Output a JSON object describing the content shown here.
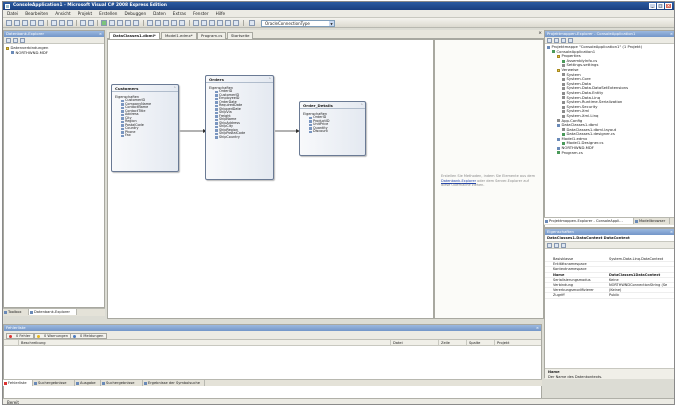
{
  "window": {
    "title": "ConsoleApplication1 - Microsoft Visual C# 2008 Express Edition",
    "controls": [
      "_",
      "□",
      "×"
    ]
  },
  "menu": [
    "Datei",
    "Bearbeiten",
    "Ansicht",
    "Projekt",
    "Erstellen",
    "Debuggen",
    "Daten",
    "Extras",
    "Fenster",
    "Hilfe"
  ],
  "toolbar": {
    "connection_type": "OracleConnectionType"
  },
  "db_explorer": {
    "title": "Datenbank-Explorer",
    "items": [
      {
        "label": "Datenverbindungen",
        "level": 0,
        "icon": "folder-icon"
      },
      {
        "label": "NORTHWND.MDF",
        "level": 1,
        "icon": "database-icon"
      }
    ],
    "tabs": [
      "Toolbox",
      "Datenbank-Explorer"
    ]
  },
  "doc_tabs": [
    "DataClasses1.dbml*",
    "Model1.edmx*",
    "Program.cs",
    "Startseite"
  ],
  "designer": {
    "entities": [
      {
        "name": "Customers",
        "section": "Eigenschaften",
        "props": [
          "CustomerID",
          "CompanyName",
          "ContactName",
          "ContactTitle",
          "Address",
          "City",
          "Region",
          "PostalCode",
          "Country",
          "Phone",
          "Fax"
        ]
      },
      {
        "name": "Orders",
        "section": "Eigenschaften",
        "props": [
          "OrderID",
          "CustomerID",
          "EmployeeID",
          "OrderDate",
          "RequiredDate",
          "ShippedDate",
          "ShipVia",
          "Freight",
          "ShipName",
          "ShipAddress",
          "ShipCity",
          "ShipRegion",
          "ShipPostalCode",
          "ShipCountry"
        ]
      },
      {
        "name": "Order_Details",
        "section": "Eigenschaften",
        "props": [
          "OrderID",
          "ProductID",
          "UnitPrice",
          "Quantity",
          "Discount"
        ]
      }
    ]
  },
  "methods_pane": {
    "text1": "Erstellen Sie Methoden, indem Sie Elemente aus dem",
    "link": "Datenbank-Explorer",
    "text2": "oder dem Server-Explorer auf diese Oberfläche ziehen."
  },
  "solution_explorer": {
    "title": "Projektmappen-Explorer - ConsoleApplication1",
    "items": [
      {
        "label": "Projektmappe \"ConsoleApplication1\" (1 Projekt)",
        "level": 0,
        "icon": "solution-icon"
      },
      {
        "label": "ConsoleApplication1",
        "level": 1,
        "icon": "project-icon"
      },
      {
        "label": "Properties",
        "level": 2,
        "icon": "folder-icon"
      },
      {
        "label": "AssemblyInfo.cs",
        "level": 3,
        "icon": "cs-file-icon"
      },
      {
        "label": "Settings.settings",
        "level": 3,
        "icon": "settings-icon"
      },
      {
        "label": "Verweise",
        "level": 2,
        "icon": "folder-icon"
      },
      {
        "label": "System",
        "level": 3,
        "icon": "reference-icon"
      },
      {
        "label": "System.Core",
        "level": 3,
        "icon": "reference-icon"
      },
      {
        "label": "System.Data",
        "level": 3,
        "icon": "reference-icon"
      },
      {
        "label": "System.Data.DataSetExtensions",
        "level": 3,
        "icon": "reference-icon"
      },
      {
        "label": "System.Data.Entity",
        "level": 3,
        "icon": "reference-icon"
      },
      {
        "label": "System.Data.Linq",
        "level": 3,
        "icon": "reference-icon"
      },
      {
        "label": "System.Runtime.Serialization",
        "level": 3,
        "icon": "reference-icon"
      },
      {
        "label": "System.Security",
        "level": 3,
        "icon": "reference-icon"
      },
      {
        "label": "System.Xml",
        "level": 3,
        "icon": "reference-icon"
      },
      {
        "label": "System.Xml.Linq",
        "level": 3,
        "icon": "reference-icon"
      },
      {
        "label": "App.Config",
        "level": 2,
        "icon": "config-icon"
      },
      {
        "label": "DataClasses1.dbml",
        "level": 2,
        "icon": "dbml-icon"
      },
      {
        "label": "DataClasses1.dbml.layout",
        "level": 3,
        "icon": "file-icon"
      },
      {
        "label": "DataClasses1.designer.cs",
        "level": 3,
        "icon": "cs-file-icon"
      },
      {
        "label": "Model1.edmx",
        "level": 2,
        "icon": "edmx-icon"
      },
      {
        "label": "Model1.Designer.cs",
        "level": 3,
        "icon": "cs-file-icon"
      },
      {
        "label": "NORTHWND.MDF",
        "level": 2,
        "icon": "database-icon"
      },
      {
        "label": "Program.cs",
        "level": 2,
        "icon": "cs-file-icon"
      }
    ],
    "tabs": [
      "Projektmappen-Explorer - ConsoleAppli...",
      "Modellbrowser"
    ]
  },
  "properties": {
    "title": "Eigenschaften",
    "object": "DataClasses1.DataContext DataContext",
    "rows": [
      {
        "key": "Basisklasse",
        "value": "System.Data.Linq.DataContext",
        "bold": false
      },
      {
        "key": "Entitätsnamespace",
        "value": "",
        "bold": false
      },
      {
        "key": "Kontextnamespace",
        "value": "",
        "bold": false
      },
      {
        "key": "Name",
        "value": "DataClasses1DataContext",
        "bold": true
      },
      {
        "key": "Serialisierungsmodus",
        "value": "Keine",
        "bold": false
      },
      {
        "key": "Verbindung",
        "value": "NORTHWNDConnectionString (Se",
        "bold": false
      },
      {
        "key": "Vererbungsmodifizierer",
        "value": "(Keine)",
        "bold": false
      },
      {
        "key": "Zugriff",
        "value": "Public",
        "bold": false
      }
    ],
    "desc_title": "Name",
    "desc_text": "Der Name des Datenkontexts."
  },
  "error_list": {
    "title": "Fehlerliste",
    "filters": [
      "0 Fehler",
      "0 Warnungen",
      "0 Meldungen"
    ],
    "columns": [
      "Beschreibung",
      "Datei",
      "Zeile",
      "Spalte",
      "Projekt"
    ]
  },
  "bottom_tabs": [
    "Fehlerliste",
    "Suchergebnisse",
    "Ausgabe",
    "Suchergebnisse",
    "Ergebnisse der Symbolsuche"
  ],
  "status": "Bereit"
}
